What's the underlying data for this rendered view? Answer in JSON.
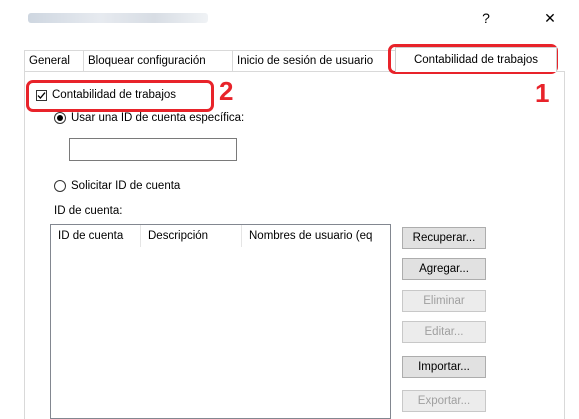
{
  "window": {
    "help_label": "?",
    "close_label": "✕"
  },
  "tabs": [
    {
      "label": "General"
    },
    {
      "label": "Bloquear configuración"
    },
    {
      "label": "Inicio de sesión de usuario"
    },
    {
      "label": "Contabilidad de trabajos"
    }
  ],
  "callouts": {
    "one": "1",
    "two": "2"
  },
  "job_accounting": {
    "enabled_label": "Contabilidad de trabajos",
    "enabled": true,
    "use_specific_label": "Usar una ID de cuenta específica:",
    "specific_value": "",
    "prompt_label": "Solicitar ID de cuenta",
    "account_id_label": "ID de cuenta:",
    "columns": [
      "ID de cuenta",
      "Descripción",
      "Nombres de usuario (eq"
    ]
  },
  "buttons": {
    "retrieve": "Recuperar...",
    "add": "Agregar...",
    "delete": "Eliminar",
    "edit": "Editar...",
    "import": "Importar...",
    "export": "Exportar..."
  },
  "colors": {
    "highlight": "#e8232a"
  }
}
